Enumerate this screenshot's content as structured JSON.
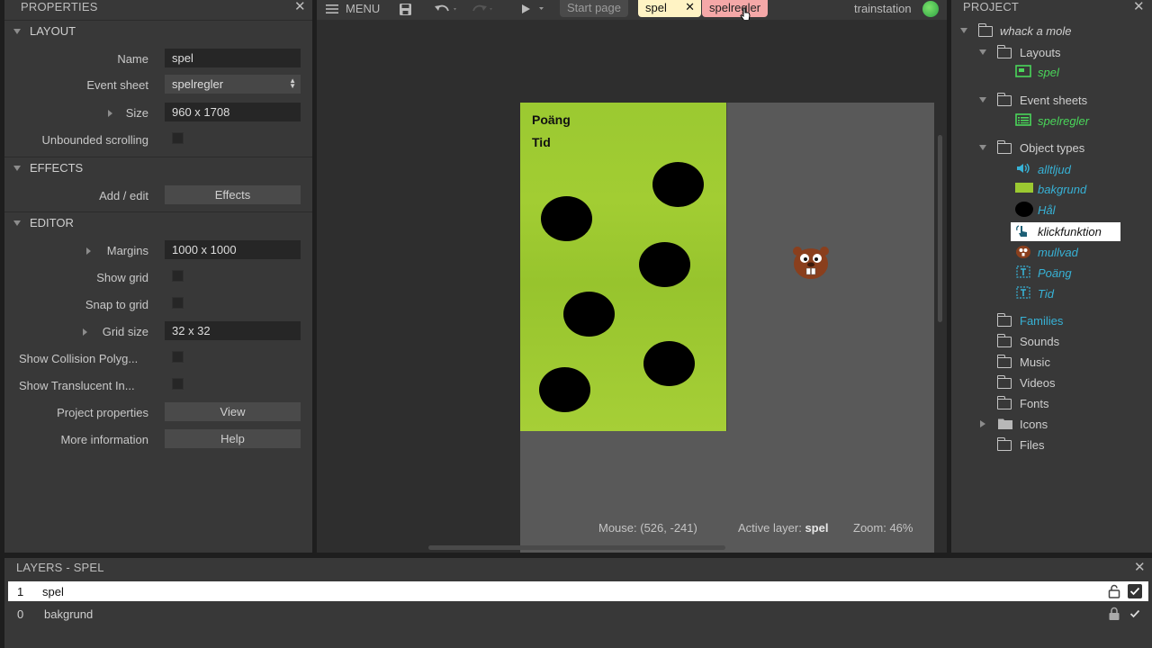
{
  "properties": {
    "title": "PROPERTIES",
    "sections": {
      "layout": "LAYOUT",
      "effects": "EFFECTS",
      "editor": "EDITOR"
    },
    "layout": {
      "name_label": "Name",
      "name_value": "spel",
      "eventsheet_label": "Event sheet",
      "eventsheet_value": "spelregler",
      "size_label": "Size",
      "size_value": "960 x 1708",
      "unbounded_label": "Unbounded scrolling"
    },
    "effects": {
      "addedit_label": "Add / edit",
      "effects_button": "Effects"
    },
    "editor": {
      "margins_label": "Margins",
      "margins_value": "1000 x 1000",
      "showgrid_label": "Show grid",
      "snaptogrid_label": "Snap to grid",
      "gridsize_label": "Grid size",
      "gridsize_value": "32 x 32",
      "showcollision_label": "Show Collision Polyg...",
      "showtranslucent_label": "Show Translucent In...",
      "projectprops_label": "Project properties",
      "view_button": "View",
      "moreinfo_label": "More information",
      "help_button": "Help"
    }
  },
  "topbar": {
    "menu_label": "MENU",
    "tabs": [
      "Start page",
      "spel",
      "spelregler"
    ],
    "user": "trainstation"
  },
  "canvas": {
    "text_objects": [
      "Poäng",
      "Tid"
    ],
    "mouse": "Mouse: (526, -241)",
    "active_layer_label": "Active layer:",
    "active_layer_value": "spel",
    "zoom": "Zoom: 46%"
  },
  "project": {
    "title": "PROJECT",
    "root": "whack a mole",
    "layouts_folder": "Layouts",
    "layout_item": "spel",
    "eventsheets_folder": "Event sheets",
    "eventsheet_item": "spelregler",
    "objecttypes_folder": "Object types",
    "object_types": [
      "alltljud",
      "bakgrund",
      "Hål",
      "klickfunktion",
      "mullvad",
      "Poäng",
      "Tid"
    ],
    "folders": [
      "Families",
      "Sounds",
      "Music",
      "Videos",
      "Fonts",
      "Icons",
      "Files"
    ]
  },
  "layers": {
    "title": "LAYERS - SPEL",
    "rows": [
      {
        "num": "1",
        "name": "spel"
      },
      {
        "num": "0",
        "name": "bakgrund"
      }
    ]
  },
  "colors": {
    "panel_bg": "#383838",
    "selected_row": "#ffffff",
    "green_text": "#4ad65a",
    "family_text": "#37b2d6",
    "tab_spel": "#fff3c4",
    "tab_spelregler": "#f5a8a8",
    "grass": "#9fcb33"
  }
}
